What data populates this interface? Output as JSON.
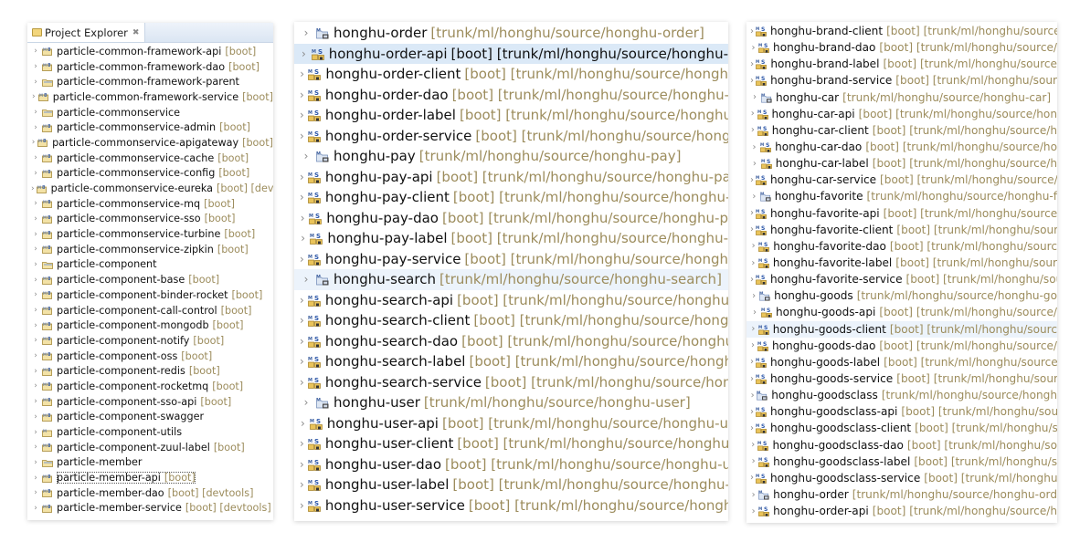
{
  "left_panel": {
    "tab_title": "Project Explorer",
    "tab_close": "✖",
    "items": [
      {
        "name": "particle-common-framework-api",
        "deco": "[boot]",
        "icon": "maven-boot-project-icon"
      },
      {
        "name": "particle-common-framework-dao",
        "deco": "[boot]",
        "icon": "maven-boot-project-icon"
      },
      {
        "name": "particle-common-framework-parent",
        "deco": "",
        "icon": "maven-parent-project-icon"
      },
      {
        "name": "particle-common-framework-service",
        "deco": "[boot]",
        "icon": "maven-boot-project-icon"
      },
      {
        "name": "particle-commonservice",
        "deco": "",
        "icon": "maven-parent-project-icon"
      },
      {
        "name": "particle-commonservice-admin",
        "deco": "[boot]",
        "icon": "maven-boot-project-icon"
      },
      {
        "name": "particle-commonservice-apigateway",
        "deco": "[boot]",
        "icon": "maven-boot-project-icon"
      },
      {
        "name": "particle-commonservice-cache",
        "deco": "[boot]",
        "icon": "maven-boot-project-icon"
      },
      {
        "name": "particle-commonservice-config",
        "deco": "[boot]",
        "icon": "maven-boot-project-icon"
      },
      {
        "name": "particle-commonservice-eureka",
        "deco": "[boot] [devtools]",
        "icon": "maven-boot-project-icon"
      },
      {
        "name": "particle-commonservice-mq",
        "deco": "[boot]",
        "icon": "maven-boot-project-icon"
      },
      {
        "name": "particle-commonservice-sso",
        "deco": "[boot]",
        "icon": "maven-boot-project-icon"
      },
      {
        "name": "particle-commonservice-turbine",
        "deco": "[boot]",
        "icon": "maven-boot-project-icon"
      },
      {
        "name": "particle-commonservice-zipkin",
        "deco": "[boot]",
        "icon": "maven-boot-project-icon"
      },
      {
        "name": "particle-component",
        "deco": "",
        "icon": "maven-parent-project-icon"
      },
      {
        "name": "particle-component-base",
        "deco": "[boot]",
        "icon": "maven-boot-project-icon"
      },
      {
        "name": "particle-component-binder-rocket",
        "deco": "[boot]",
        "icon": "maven-boot-project-icon"
      },
      {
        "name": "particle-component-call-control",
        "deco": "[boot]",
        "icon": "maven-boot-project-icon"
      },
      {
        "name": "particle-component-mongodb",
        "deco": "[boot]",
        "icon": "maven-boot-project-icon"
      },
      {
        "name": "particle-component-notify",
        "deco": "[boot]",
        "icon": "maven-boot-project-icon"
      },
      {
        "name": "particle-component-oss",
        "deco": "[boot]",
        "icon": "maven-boot-project-icon"
      },
      {
        "name": "particle-component-redis",
        "deco": "[boot]",
        "icon": "maven-boot-project-icon"
      },
      {
        "name": "particle-component-rocketmq",
        "deco": "[boot]",
        "icon": "maven-boot-project-icon"
      },
      {
        "name": "particle-component-sso-api",
        "deco": "[boot]",
        "icon": "maven-boot-project-icon"
      },
      {
        "name": "particle-component-swagger",
        "deco": "",
        "icon": "maven-boot-project-icon"
      },
      {
        "name": "particle-component-utils",
        "deco": "",
        "icon": "maven-project-icon"
      },
      {
        "name": "particle-component-zuul-label",
        "deco": "[boot]",
        "icon": "maven-boot-project-icon"
      },
      {
        "name": "particle-member",
        "deco": "",
        "icon": "maven-parent-project-icon"
      },
      {
        "name": "particle-member-api",
        "deco": "[boot]",
        "icon": "maven-boot-project-icon",
        "focused": true
      },
      {
        "name": "particle-member-dao",
        "deco": "[boot] [devtools]",
        "icon": "maven-boot-project-icon"
      },
      {
        "name": "particle-member-service",
        "deco": "[boot] [devtools]",
        "icon": "maven-boot-project-icon"
      }
    ]
  },
  "middle_panel": {
    "items": [
      {
        "name": "honghu-order",
        "deco": "[trunk/ml/honghu/source/honghu-order]",
        "icon": "svn-parent-project-icon"
      },
      {
        "name": "honghu-order-api",
        "deco": "[boot] [trunk/ml/honghu/source/honghu-",
        "icon": "svn-boot-project-icon",
        "selected": true
      },
      {
        "name": "honghu-order-client",
        "deco": "[boot] [trunk/ml/honghu/source/hongh",
        "icon": "svn-boot-project-icon"
      },
      {
        "name": "honghu-order-dao",
        "deco": "[boot] [trunk/ml/honghu/source/honghu-",
        "icon": "svn-boot-project-icon"
      },
      {
        "name": "honghu-order-label",
        "deco": "[boot] [trunk/ml/honghu/source/honghu",
        "icon": "svn-boot-project-icon"
      },
      {
        "name": "honghu-order-service",
        "deco": "[boot] [trunk/ml/honghu/source/hong",
        "icon": "svn-boot-project-icon"
      },
      {
        "name": "honghu-pay",
        "deco": "[trunk/ml/honghu/source/honghu-pay]",
        "icon": "svn-parent-project-icon"
      },
      {
        "name": "honghu-pay-api",
        "deco": "[boot] [trunk/ml/honghu/source/honghu-pa",
        "icon": "svn-boot-project-icon"
      },
      {
        "name": "honghu-pay-client",
        "deco": "[boot] [trunk/ml/honghu/source/honghu-",
        "icon": "svn-boot-project-icon"
      },
      {
        "name": "honghu-pay-dao",
        "deco": "[boot] [trunk/ml/honghu/source/honghu-p",
        "icon": "svn-boot-project-icon"
      },
      {
        "name": "honghu-pay-label",
        "deco": "[boot] [trunk/ml/honghu/source/honghu-",
        "icon": "svn-boot-project-icon"
      },
      {
        "name": "honghu-pay-service",
        "deco": "[boot] [trunk/ml/honghu/source/honghu",
        "icon": "svn-boot-project-icon"
      },
      {
        "name": "honghu-search",
        "deco": "[trunk/ml/honghu/source/honghu-search]",
        "icon": "svn-parent-project-icon",
        "hover": true
      },
      {
        "name": "honghu-search-api",
        "deco": "[boot] [trunk/ml/honghu/source/honghu",
        "icon": "svn-boot-project-icon"
      },
      {
        "name": "honghu-search-client",
        "deco": "[boot] [trunk/ml/honghu/source/hongl",
        "icon": "svn-boot-project-icon"
      },
      {
        "name": "honghu-search-dao",
        "deco": "[boot] [trunk/ml/honghu/source/honghu",
        "icon": "svn-boot-project-icon"
      },
      {
        "name": "honghu-search-label",
        "deco": "[boot] [trunk/ml/honghu/source/hongh",
        "icon": "svn-boot-project-icon"
      },
      {
        "name": "honghu-search-service",
        "deco": "[boot] [trunk/ml/honghu/source/hong",
        "icon": "svn-boot-project-icon"
      },
      {
        "name": "honghu-user",
        "deco": "[trunk/ml/honghu/source/honghu-user]",
        "icon": "svn-parent-project-icon"
      },
      {
        "name": "honghu-user-api",
        "deco": "[boot] [trunk/ml/honghu/source/honghu-u",
        "icon": "svn-boot-project-icon"
      },
      {
        "name": "honghu-user-client",
        "deco": "[boot] [trunk/ml/honghu/source/honghu",
        "icon": "svn-boot-project-icon"
      },
      {
        "name": "honghu-user-dao",
        "deco": "[boot] [trunk/ml/honghu/source/honghu-u",
        "icon": "svn-boot-project-icon"
      },
      {
        "name": "honghu-user-label",
        "deco": "[boot] [trunk/ml/honghu/source/honghu-",
        "icon": "svn-boot-project-icon"
      },
      {
        "name": "honghu-user-service",
        "deco": "[boot] [trunk/ml/honghu/source/hongh",
        "icon": "svn-boot-project-icon"
      }
    ]
  },
  "right_panel": {
    "items": [
      {
        "name": "honghu-brand-client",
        "deco": "[boot] [trunk/ml/honghu/source",
        "icon": "svn-boot-project-icon"
      },
      {
        "name": "honghu-brand-dao",
        "deco": "[boot] [trunk/ml/honghu/source/",
        "icon": "svn-boot-project-icon"
      },
      {
        "name": "honghu-brand-label",
        "deco": "[boot] [trunk/ml/honghu/source",
        "icon": "svn-boot-project-icon"
      },
      {
        "name": "honghu-brand-service",
        "deco": "[boot] [trunk/ml/honghu/sour",
        "icon": "svn-boot-project-icon"
      },
      {
        "name": "honghu-car",
        "deco": "[trunk/ml/honghu/source/honghu-car]",
        "icon": "svn-parent-project-icon"
      },
      {
        "name": "honghu-car-api",
        "deco": "[boot] [trunk/ml/honghu/source/hon",
        "icon": "svn-boot-project-icon"
      },
      {
        "name": "honghu-car-client",
        "deco": "[boot] [trunk/ml/honghu/source/h",
        "icon": "svn-boot-project-icon"
      },
      {
        "name": "honghu-car-dao",
        "deco": "[boot] [trunk/ml/honghu/source/ho",
        "icon": "svn-boot-project-icon"
      },
      {
        "name": "honghu-car-label",
        "deco": "[boot] [trunk/ml/honghu/source/h",
        "icon": "svn-boot-project-icon"
      },
      {
        "name": "honghu-car-service",
        "deco": "[boot] [trunk/ml/honghu/source/",
        "icon": "svn-boot-project-icon"
      },
      {
        "name": "honghu-favorite",
        "deco": "[trunk/ml/honghu/source/honghu-f",
        "icon": "svn-parent-project-icon"
      },
      {
        "name": "honghu-favorite-api",
        "deco": "[boot] [trunk/ml/honghu/source",
        "icon": "svn-boot-project-icon"
      },
      {
        "name": "honghu-favorite-client",
        "deco": "[boot] [trunk/ml/honghu/sour",
        "icon": "svn-boot-project-icon"
      },
      {
        "name": "honghu-favorite-dao",
        "deco": "[boot] [trunk/ml/honghu/sourc",
        "icon": "svn-boot-project-icon"
      },
      {
        "name": "honghu-favorite-label",
        "deco": "[boot] [trunk/ml/honghu/sour",
        "icon": "svn-boot-project-icon"
      },
      {
        "name": "honghu-favorite-service",
        "deco": "[boot] [trunk/ml/honghu/sou",
        "icon": "svn-boot-project-icon"
      },
      {
        "name": "honghu-goods",
        "deco": "[trunk/ml/honghu/source/honghu-go",
        "icon": "svn-parent-project-icon"
      },
      {
        "name": "honghu-goods-api",
        "deco": "[boot] [trunk/ml/honghu/source/",
        "icon": "svn-boot-project-icon"
      },
      {
        "name": "honghu-goods-client",
        "deco": "[boot] [trunk/ml/honghu/sourc",
        "icon": "svn-boot-project-icon",
        "hover": true
      },
      {
        "name": "honghu-goods-dao",
        "deco": "[boot] [trunk/ml/honghu/source/",
        "icon": "svn-boot-project-icon"
      },
      {
        "name": "honghu-goods-label",
        "deco": "[boot] [trunk/ml/honghu/source",
        "icon": "svn-boot-project-icon"
      },
      {
        "name": "honghu-goods-service",
        "deco": "[boot] [trunk/ml/honghu/sour",
        "icon": "svn-boot-project-icon"
      },
      {
        "name": "honghu-goodsclass",
        "deco": "[trunk/ml/honghu/source/hongh",
        "icon": "svn-parent-project-icon"
      },
      {
        "name": "honghu-goodsclass-api",
        "deco": "[boot] [trunk/ml/honghu/sou",
        "icon": "svn-boot-project-icon"
      },
      {
        "name": "honghu-goodsclass-client",
        "deco": "[boot] [trunk/ml/honghu/s",
        "icon": "svn-boot-project-icon"
      },
      {
        "name": "honghu-goodsclass-dao",
        "deco": "[boot] [trunk/ml/honghu/so",
        "icon": "svn-boot-project-icon"
      },
      {
        "name": "honghu-goodsclass-label",
        "deco": "[boot] [trunk/ml/honghu/s",
        "icon": "svn-boot-project-icon"
      },
      {
        "name": "honghu-goodsclass-service",
        "deco": "[boot] [trunk/ml/honghu/",
        "icon": "svn-boot-project-icon"
      },
      {
        "name": "honghu-order",
        "deco": "[trunk/ml/honghu/source/honghu-ord",
        "icon": "svn-parent-project-icon"
      },
      {
        "name": "honghu-order-api",
        "deco": "[boot] [trunk/ml/honghu/source/h",
        "icon": "svn-boot-project-icon"
      }
    ]
  },
  "glyphs": {
    "expand": "›"
  },
  "colors": {
    "decoration": "#9c8c5c",
    "selection": "#dbe9f7",
    "hover": "#ecf3fb",
    "text": "#111111"
  }
}
